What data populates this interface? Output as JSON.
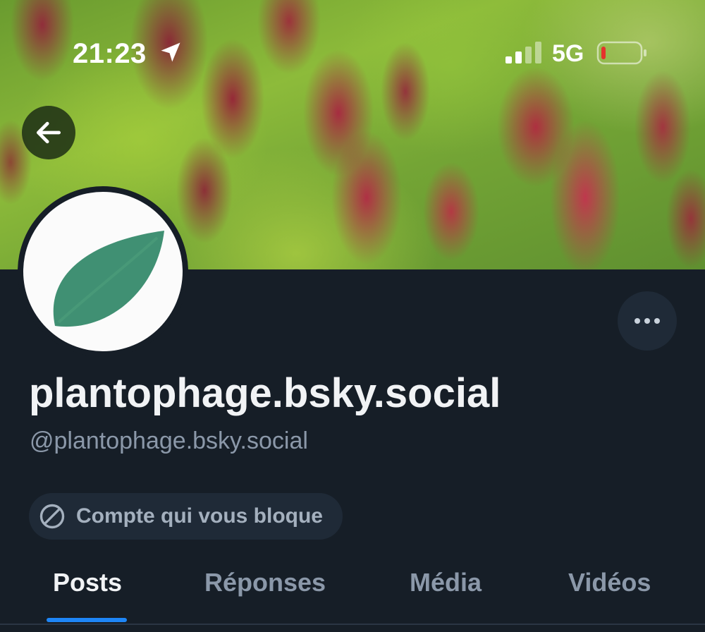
{
  "status_bar": {
    "time": "21:23",
    "network": "5G",
    "icons": [
      "location-arrow-icon",
      "cellular-signal-icon",
      "battery-low-icon"
    ],
    "battery_color": "#e5322c"
  },
  "header": {
    "back_icon": "arrow-left-icon",
    "banner_description": "blurred photo of crimson clover flowers",
    "more_icon": "ellipsis-horizontal-icon"
  },
  "profile": {
    "avatar_icon": "leaf-icon",
    "display_name": "plantophage.bsky.social",
    "handle": "@plantophage.bsky.social",
    "blocked_badge": {
      "icon": "block-icon",
      "label": "Compte qui vous bloque"
    }
  },
  "tabs": [
    {
      "label": "Posts",
      "active": true
    },
    {
      "label": "Réponses",
      "active": false
    },
    {
      "label": "Média",
      "active": false
    },
    {
      "label": "Vidéos",
      "active": false
    }
  ],
  "colors": {
    "background": "#161e27",
    "surface": "#1f2a37",
    "text_primary": "#f1f3f5",
    "text_secondary": "#8b98a9",
    "accent": "#1e86f7",
    "avatar_leaf": "#1f7d5a"
  }
}
